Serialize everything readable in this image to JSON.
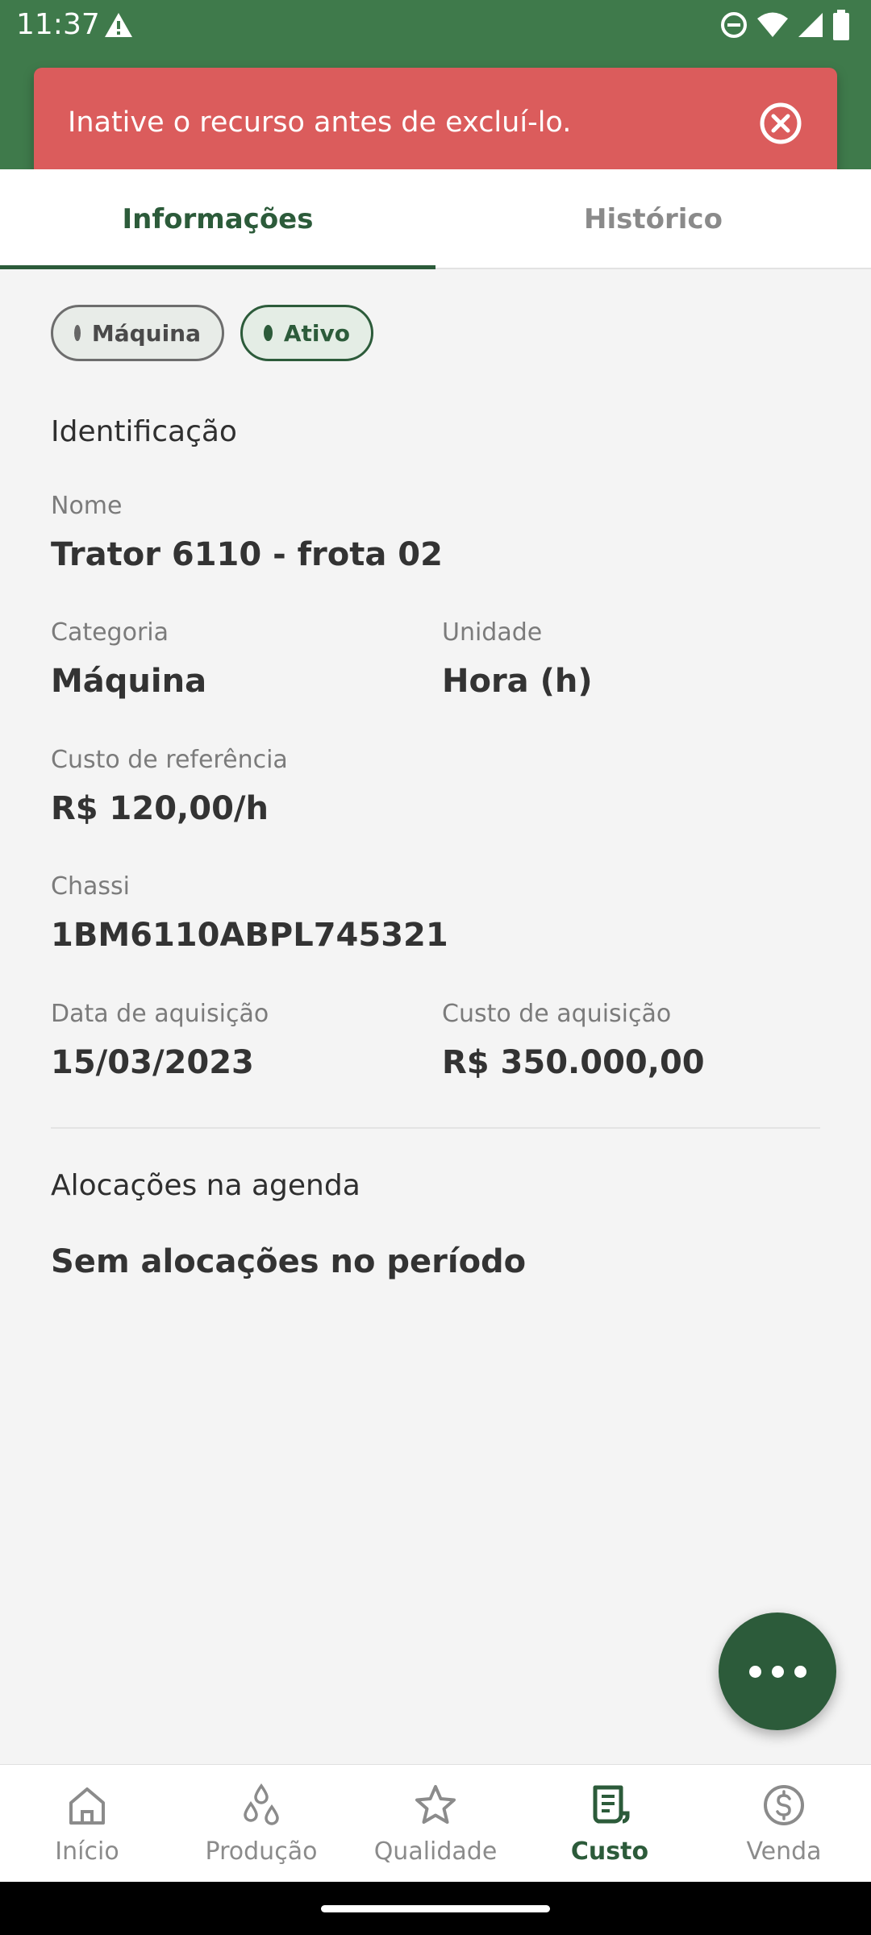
{
  "status_bar": {
    "time": "11:37",
    "icons": [
      "warning-icon",
      "do-not-disturb-icon",
      "wifi-icon",
      "signal-icon",
      "battery-icon"
    ]
  },
  "toast": {
    "message": "Inative o recurso antes de excluí-lo.",
    "background_color": "#db5c5c",
    "close_icon": "close-circle-icon"
  },
  "tabs": [
    {
      "label": "Informações",
      "active": true
    },
    {
      "label": "Histórico",
      "active": false
    }
  ],
  "chips": [
    {
      "label": "Máquina"
    },
    {
      "label": "Ativo"
    }
  ],
  "identification": {
    "section_title": "Identificação",
    "nome_label": "Nome",
    "nome_value": "Trator 6110 - frota 02",
    "categoria_label": "Categoria",
    "categoria_value": "Máquina",
    "unidade_label": "Unidade",
    "unidade_value": "Hora (h)",
    "custo_ref_label": "Custo de referência",
    "custo_ref_value": "R$ 120,00/h",
    "chassi_label": "Chassi",
    "chassi_value": "1BM6110ABPL745321",
    "data_aquisicao_label": "Data de aquisição",
    "data_aquisicao_value": "15/03/2023",
    "custo_aquisicao_label": "Custo de aquisição",
    "custo_aquisicao_value": "R$ 350.000,00"
  },
  "allocations": {
    "section_title": "Alocações na agenda",
    "empty_text": "Sem alocações no período"
  },
  "fab": {
    "icon": "more-horizontal-icon"
  },
  "bottom_nav": [
    {
      "label": "Início",
      "icon": "home-icon",
      "active": false
    },
    {
      "label": "Produção",
      "icon": "drops-icon",
      "active": false
    },
    {
      "label": "Qualidade",
      "icon": "star-icon",
      "active": false
    },
    {
      "label": "Custo",
      "icon": "receipt-icon",
      "active": true
    },
    {
      "label": "Venda",
      "icon": "dollar-circle-icon",
      "active": false
    }
  ],
  "colors": {
    "primary": "#2c5b3a",
    "header": "#3f7a4b",
    "toast": "#db5c5c",
    "background": "#f4f4f4"
  }
}
